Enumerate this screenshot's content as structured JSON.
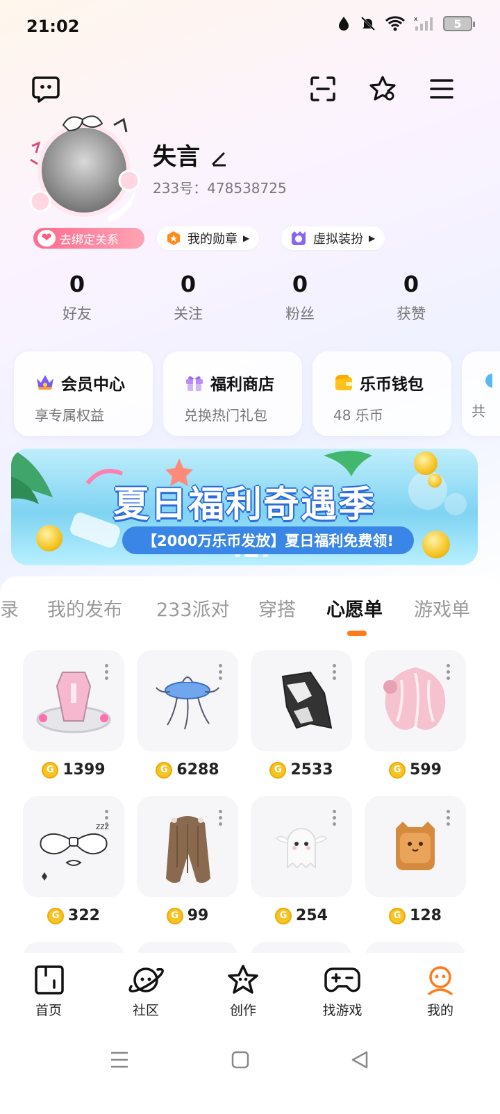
{
  "status_bar": {
    "time": "21:02",
    "battery": "5",
    "icons": [
      "data-drop-icon",
      "bell-muted-icon",
      "wifi-icon",
      "signal-icon",
      "battery-icon"
    ]
  },
  "header": {
    "icons": [
      "chat-bubble-icon",
      "scan-icon",
      "star-badge-icon",
      "menu-icon"
    ]
  },
  "profile": {
    "name": "失言",
    "id_text": "233号：478538725",
    "relation_badge": "去绑定关系",
    "medal_label": "我的勋章",
    "outfit_label": "虚拟装扮"
  },
  "stats": [
    {
      "value": "0",
      "label": "好友"
    },
    {
      "value": "0",
      "label": "关注"
    },
    {
      "value": "0",
      "label": "粉丝"
    },
    {
      "value": "0",
      "label": "获赞"
    }
  ],
  "services": [
    {
      "title": "会员中心",
      "sub": "享专属权益",
      "icon": "crown-icon"
    },
    {
      "title": "福利商店",
      "sub": "兑换热门礼包",
      "icon": "gift-icon"
    },
    {
      "title": "乐币钱包",
      "sub": "48 乐币",
      "icon": "wallet-icon"
    },
    {
      "title": "",
      "sub": "共",
      "icon": "partial-icon"
    }
  ],
  "banner": {
    "title": "夏日福利奇遇季",
    "subtitle": "【2000万乐币发放】夏日福利免费领!",
    "active_dot": 1
  },
  "tabs": [
    {
      "label": "录",
      "active": false
    },
    {
      "label": "我的发布",
      "active": false
    },
    {
      "label": "233派对",
      "active": false
    },
    {
      "label": "穿搭",
      "active": false
    },
    {
      "label": "心愿单",
      "active": true
    },
    {
      "label": "游戏单",
      "active": false
    }
  ],
  "wishlist": [
    {
      "price": "1399",
      "item": "pink-crystal-coffin-headpiece"
    },
    {
      "price": "6288",
      "item": "blue-jellyfish-accessory"
    },
    {
      "price": "2533",
      "item": "black-white-cape"
    },
    {
      "price": "599",
      "item": "pink-flower-hair"
    },
    {
      "price": "322",
      "item": "white-bow-sketch"
    },
    {
      "price": "99",
      "item": "long-brown-hair"
    },
    {
      "price": "254",
      "item": "white-ghost-pet"
    },
    {
      "price": "128",
      "item": "toast-cat-pet"
    }
  ],
  "coin_glyph": "G",
  "bottom_nav": [
    {
      "label": "首页",
      "icon": "home-icon",
      "active": false
    },
    {
      "label": "社区",
      "icon": "planet-icon",
      "active": false
    },
    {
      "label": "创作",
      "icon": "star-create-icon",
      "active": false
    },
    {
      "label": "找游戏",
      "icon": "gamepad-icon",
      "active": false
    },
    {
      "label": "我的",
      "icon": "profile-icon",
      "active": true
    }
  ],
  "colors": {
    "accent": "#ff7a1a",
    "coin": "#f7c325",
    "badge_pink": "#ff6b8d",
    "banner_blue": "#3a86e6"
  }
}
